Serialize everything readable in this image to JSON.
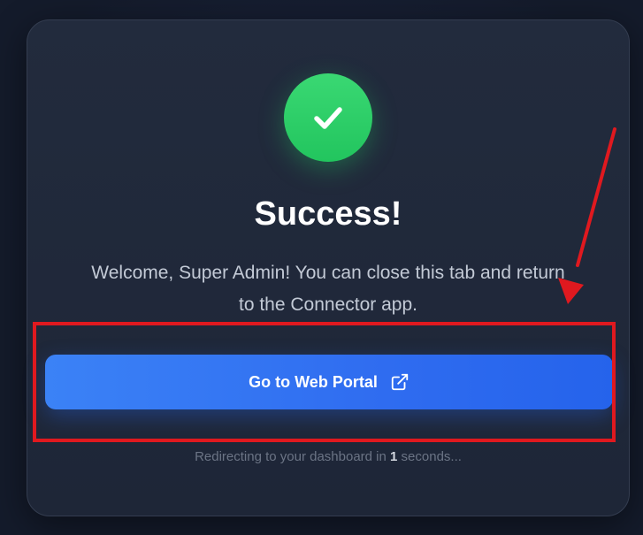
{
  "card": {
    "title": "Success!",
    "message": "Welcome, Super Admin! You can close this tab and return to the Connector app.",
    "success_icon": "checkmark-icon"
  },
  "portal_button": {
    "label": "Go to Web Portal",
    "icon": "external-link-icon"
  },
  "redirect": {
    "prefix": "Redirecting to your dashboard in",
    "seconds": "1",
    "suffix": "seconds..."
  },
  "colors": {
    "success": "#22c55e",
    "button": "#3b82f6",
    "annotation": "#e0191f"
  }
}
